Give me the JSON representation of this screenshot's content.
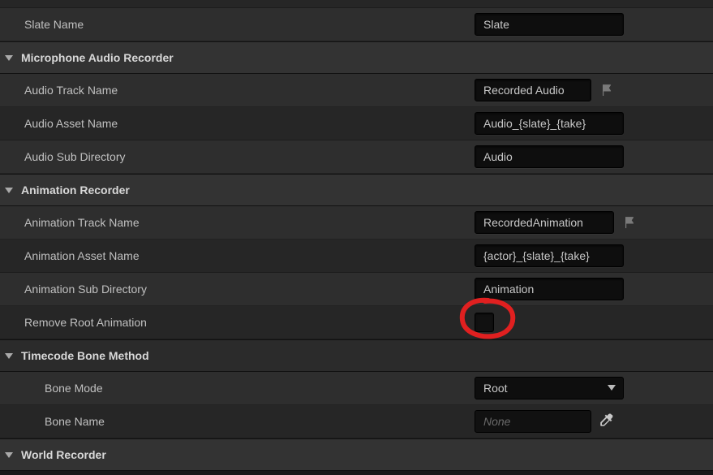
{
  "top": {
    "slate_name_label": "Slate Name",
    "slate_name_value": "Slate"
  },
  "sections": {
    "mic": {
      "title": "Microphone Audio Recorder",
      "audio_track_name_label": "Audio Track Name",
      "audio_track_name_value": "Recorded Audio",
      "audio_asset_name_label": "Audio Asset Name",
      "audio_asset_name_value": "Audio_{slate}_{take}",
      "audio_sub_dir_label": "Audio Sub Directory",
      "audio_sub_dir_value": "Audio"
    },
    "anim": {
      "title": "Animation Recorder",
      "track_name_label": "Animation Track Name",
      "track_name_value": "RecordedAnimation",
      "asset_name_label": "Animation Asset Name",
      "asset_name_value": "{actor}_{slate}_{take}",
      "sub_dir_label": "Animation Sub Directory",
      "sub_dir_value": "Animation",
      "remove_root_label": "Remove Root Animation",
      "remove_root_checked": false
    },
    "timecode": {
      "title": "Timecode Bone Method",
      "bone_mode_label": "Bone Mode",
      "bone_mode_value": "Root",
      "bone_name_label": "Bone Name",
      "bone_name_placeholder": "None"
    },
    "world": {
      "title": "World Recorder"
    }
  }
}
